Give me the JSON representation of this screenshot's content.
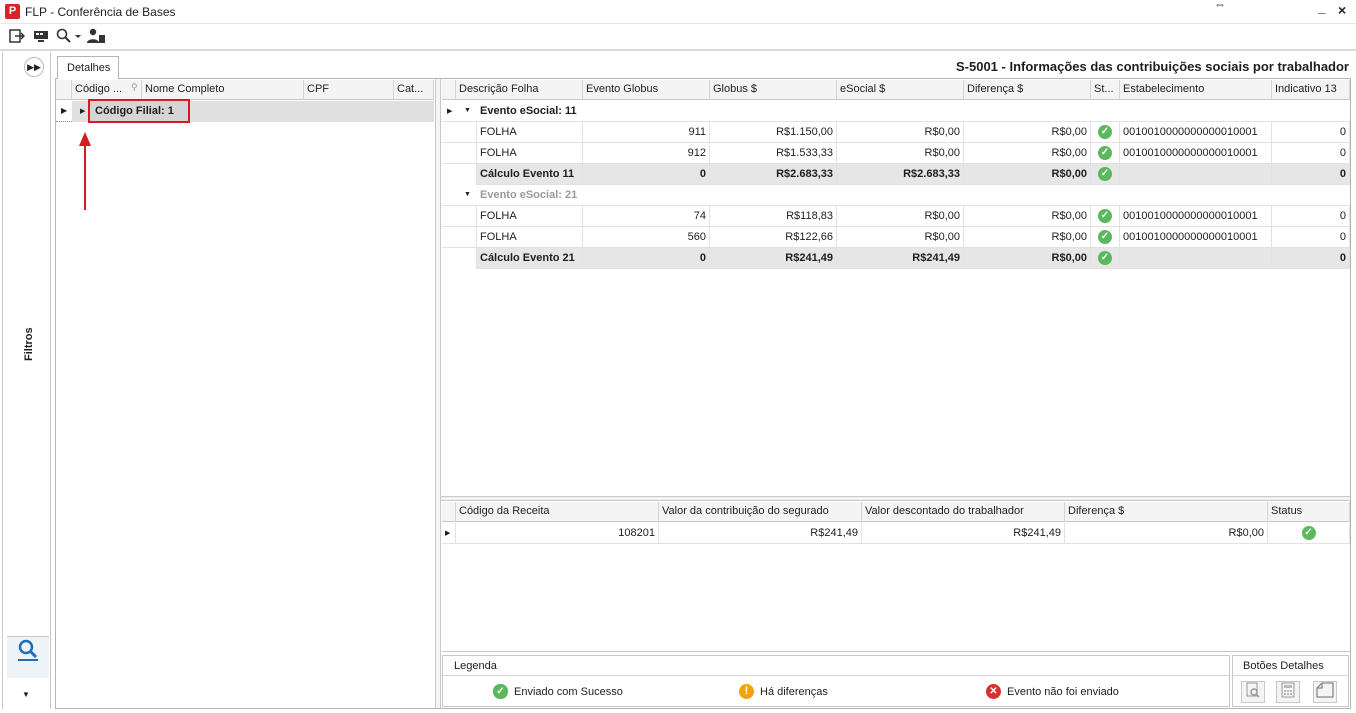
{
  "window": {
    "title": "FLP - Conferência de Bases",
    "logo": "P",
    "minimize": "_",
    "close": "×"
  },
  "toolbar": {
    "icons": [
      "exit-icon",
      "screen-icon",
      "search-icon",
      "user-icon"
    ]
  },
  "sidebar": {
    "filters_label": "Filtros",
    "search_icon": "search-user-icon"
  },
  "tab": {
    "label": "Detalhes"
  },
  "header": {
    "title": "S-5001 - Informações das contribuições sociais por trabalhador"
  },
  "left_grid": {
    "columns": [
      "Código ...",
      "Nome Completo",
      "CPF",
      "Cat..."
    ],
    "group_row": "Código Filial: 1"
  },
  "main_grid": {
    "columns": [
      "Descrição Folha",
      "Evento Globus",
      "Globus $",
      "eSocial $",
      "Diferença $",
      "St...",
      "Estabelecimento",
      "Indicativo 13"
    ],
    "groups": [
      {
        "title": "Evento eSocial: 11",
        "rows": [
          {
            "desc": "FOLHA",
            "evento": "911",
            "globus": "R$1.150,00",
            "esocial": "R$0,00",
            "dif": "R$0,00",
            "estab": "0010010000000000010001",
            "ind": "0"
          },
          {
            "desc": "FOLHA",
            "evento": "912",
            "globus": "R$1.533,33",
            "esocial": "R$0,00",
            "dif": "R$0,00",
            "estab": "0010010000000000010001",
            "ind": "0"
          }
        ],
        "total": {
          "desc": "Cálculo Evento 11",
          "evento": "0",
          "globus": "R$2.683,33",
          "esocial": "R$2.683,33",
          "dif": "R$0,00",
          "ind": "0"
        }
      },
      {
        "title": "Evento eSocial: 21",
        "rows": [
          {
            "desc": "FOLHA",
            "evento": "74",
            "globus": "R$118,83",
            "esocial": "R$0,00",
            "dif": "R$0,00",
            "estab": "0010010000000000010001",
            "ind": "0"
          },
          {
            "desc": "FOLHA",
            "evento": "560",
            "globus": "R$122,66",
            "esocial": "R$0,00",
            "dif": "R$0,00",
            "estab": "0010010000000000010001",
            "ind": "0"
          }
        ],
        "total": {
          "desc": "Cálculo Evento 21",
          "evento": "0",
          "globus": "R$241,49",
          "esocial": "R$241,49",
          "dif": "R$0,00",
          "ind": "0"
        }
      }
    ]
  },
  "bottom_grid": {
    "columns": [
      "Código da Receita",
      "Valor da contribuição do segurado",
      "Valor descontado do trabalhador",
      "Diferença $",
      "Status"
    ],
    "rows": [
      {
        "codigo": "108201",
        "valor_contrib": "R$241,49",
        "valor_desc": "R$241,49",
        "dif": "R$0,00"
      }
    ]
  },
  "legend": {
    "title": "Legenda",
    "items": [
      {
        "label": "Enviado com Sucesso",
        "icon": "check-icon",
        "color": "#5cb85c"
      },
      {
        "label": "Há diferenças",
        "icon": "warning-icon",
        "color": "#f0a30a"
      },
      {
        "label": "Evento não foi enviado",
        "icon": "error-icon",
        "color": "#d9302f"
      }
    ]
  },
  "botoes": {
    "title": "Botões Detalhes",
    "buttons": [
      "preview-icon",
      "calculator-icon",
      "document-icon"
    ]
  }
}
